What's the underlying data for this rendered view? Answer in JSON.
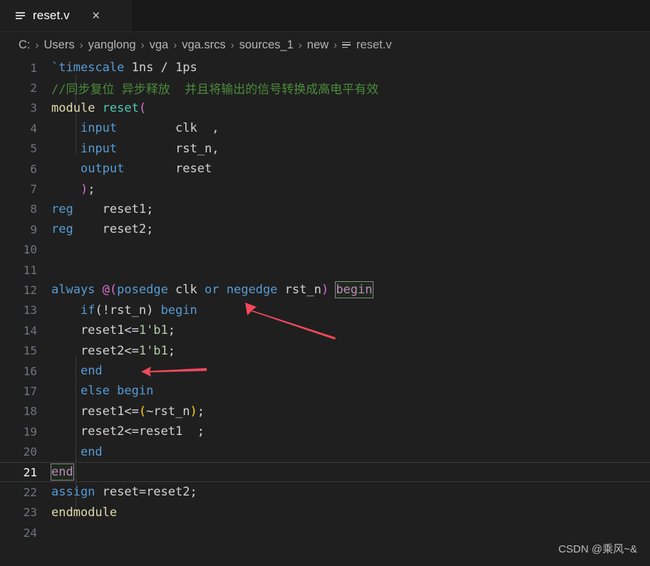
{
  "window": {
    "background": "#1f1f1f",
    "tabbar_background": "#181818"
  },
  "tab": {
    "label": "reset.v",
    "file_icon": "file-lines-icon",
    "close_icon": "close-icon",
    "close_glyph": "×",
    "active": true
  },
  "breadcrumb": {
    "items": [
      "C:",
      "Users",
      "yanglong",
      "vga",
      "vga.srcs",
      "sources_1",
      "new",
      "reset.v"
    ],
    "separator": "›",
    "file_icon": "file-lines-icon"
  },
  "editor": {
    "language": "verilog",
    "active_line": 21,
    "total_lines": 24,
    "line_numbers": [
      "1",
      "2",
      "3",
      "4",
      "5",
      "6",
      "7",
      "8",
      "9",
      "10",
      "11",
      "12",
      "13",
      "14",
      "15",
      "16",
      "17",
      "18",
      "19",
      "20",
      "21",
      "22",
      "23",
      "24"
    ],
    "lines": [
      {
        "n": "1",
        "text": "`timescale 1ns / 1ps"
      },
      {
        "n": "2",
        "text": "//同步复位 异步释放  并且将输出的信号转换成高电平有效"
      },
      {
        "n": "3",
        "text": "module reset("
      },
      {
        "n": "4",
        "text": "    input        clk  ,"
      },
      {
        "n": "5",
        "text": "    input        rst_n,"
      },
      {
        "n": "6",
        "text": "    output       reset"
      },
      {
        "n": "7",
        "text": "    );"
      },
      {
        "n": "8",
        "text": "reg    reset1;"
      },
      {
        "n": "9",
        "text": "reg    reset2;"
      },
      {
        "n": "10",
        "text": ""
      },
      {
        "n": "11",
        "text": ""
      },
      {
        "n": "12",
        "text": "always @(posedge clk or negedge rst_n) begin"
      },
      {
        "n": "13",
        "text": "    if(!rst_n) begin"
      },
      {
        "n": "14",
        "text": "    reset1<=1'b1;"
      },
      {
        "n": "15",
        "text": "    reset2<=1'b1;"
      },
      {
        "n": "16",
        "text": "    end"
      },
      {
        "n": "17",
        "text": "    else begin"
      },
      {
        "n": "18",
        "text": "    reset1<=(~rst_n);"
      },
      {
        "n": "19",
        "text": "    reset2<=reset1  ;"
      },
      {
        "n": "20",
        "text": "    end"
      },
      {
        "n": "21",
        "text": "end"
      },
      {
        "n": "22",
        "text": "assign reset=reset2;"
      },
      {
        "n": "23",
        "text": "endmodule"
      },
      {
        "n": "24",
        "text": ""
      }
    ],
    "highlighted_words": [
      "begin",
      "end"
    ],
    "colors": {
      "keyword": "#569cd6",
      "control_keyword": "#c586c0",
      "type": "#dcdcaa",
      "module_name": "#4ec9b0",
      "paren_pink": "#da70d6",
      "bracket_yellow": "#ffd700",
      "identifier": "#d4d4d4",
      "number": "#b5cea8",
      "comment": "#4a8b3a",
      "line_number": "#6e7681",
      "active_line_number": "#ffffff"
    }
  },
  "annotations": {
    "color": "#f2495c",
    "arrows": [
      {
        "name": "arrow-to-begin-line13",
        "target": "begin on line 13"
      },
      {
        "name": "arrow-to-end-line16",
        "target": "end on line 16"
      }
    ]
  },
  "watermark": {
    "text": "CSDN @乘风~&"
  }
}
